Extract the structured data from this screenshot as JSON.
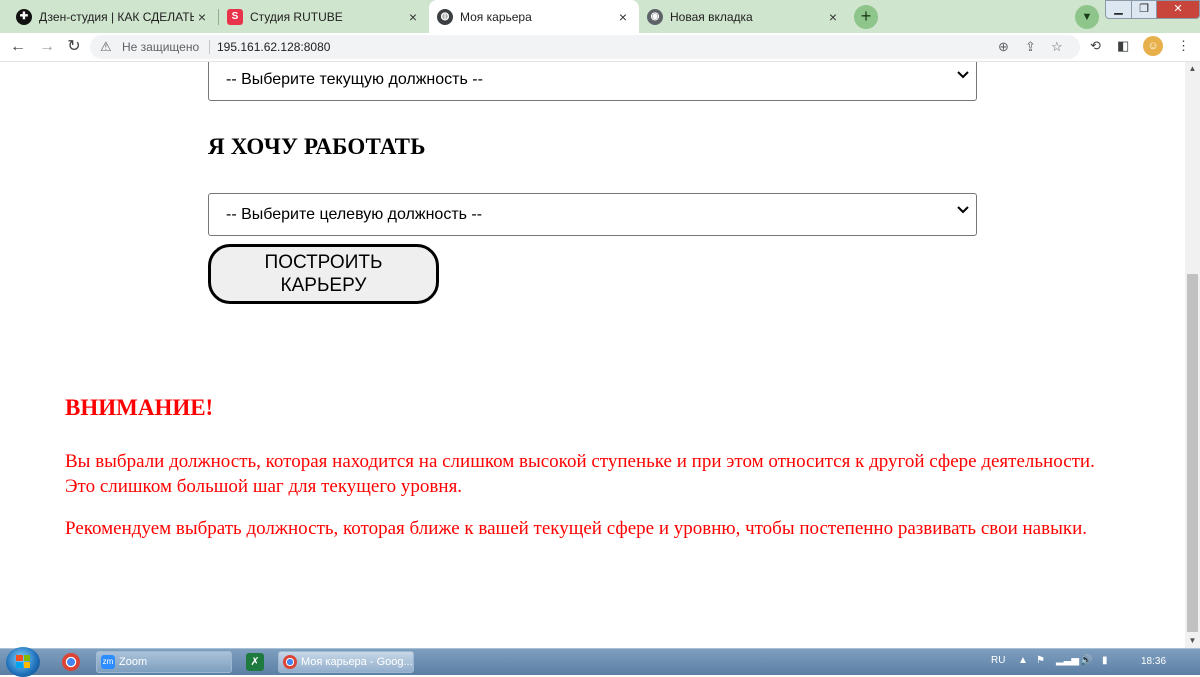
{
  "browser": {
    "tabs": [
      {
        "title": "Дзен-студия | КАК СДЕЛАТЬ КО",
        "active": false
      },
      {
        "title": "Студия RUTUBE",
        "active": false
      },
      {
        "title": "Моя карьера",
        "active": true
      },
      {
        "title": "Новая вкладка",
        "active": false
      }
    ],
    "address": {
      "security_label": "Не защищено",
      "url": "195.161.62.128:8080"
    }
  },
  "form": {
    "current_position_select": "-- Выберите текущую должность --",
    "heading": "Я ХОЧУ РАБОТАТЬ",
    "target_position_select": "-- Выберите целевую должность --",
    "build_button_line1": "ПОСТРОИТЬ",
    "build_button_line2": "КАРЬЕРУ"
  },
  "warning": {
    "title": "ВНИМАНИЕ!",
    "paragraph1": "Вы выбрали должность, которая находится на слишком высокой ступеньке и при этом относится к другой сфере деятельности. Это слишком большой шаг для текущего уровня.",
    "paragraph2": "Рекомендуем выбрать должность, которая ближе к вашей текущей сфере и уровню, чтобы постепенно развивать свои навыки.",
    "color": "#ff0000"
  },
  "taskbar": {
    "buttons": [
      {
        "label": "Zoom"
      },
      {
        "label": "Моя карьера - Goog..."
      }
    ],
    "language": "RU",
    "time": "18:36"
  },
  "colors": {
    "tab_strip": "#cfe5cd",
    "accent": "#8dc58a"
  }
}
